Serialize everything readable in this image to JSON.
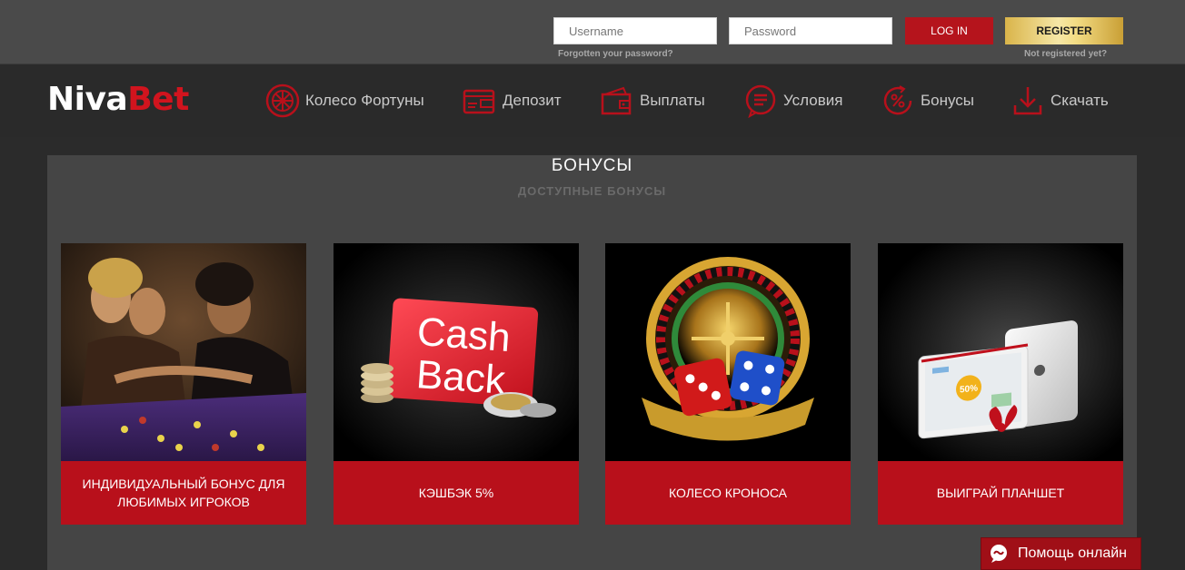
{
  "auth": {
    "username_placeholder": "Username",
    "username_value": "",
    "password_placeholder": "Password",
    "password_value": "",
    "login_label": "LOG IN",
    "register_label": "REGISTER",
    "forgot_label": "Forgotten your password?",
    "not_registered_label": "Not registered yet?"
  },
  "logo": {
    "part1": "Niva",
    "part2": "Bet"
  },
  "nav": {
    "items": [
      {
        "label": "Колесо Фортуны",
        "icon": "wheel-icon"
      },
      {
        "label": "Депозит",
        "icon": "wallet-icon"
      },
      {
        "label": "Выплаты",
        "icon": "purse-icon"
      },
      {
        "label": "Условия",
        "icon": "document-chat-icon"
      },
      {
        "label": "Бонусы",
        "icon": "percent-icon"
      },
      {
        "label": "Скачать",
        "icon": "download-icon"
      }
    ]
  },
  "bonuses": {
    "title": "БОНУСЫ",
    "subtitle": "ДОСТУПНЫЕ БОНУСЫ",
    "cards": [
      {
        "caption": "ИНДИВИДУАЛЬНЫЙ БОНУС ДЛЯ ЛЮБИМЫХ ИГРОКОВ",
        "image": "casino-players-image"
      },
      {
        "caption": "КЭШБЭК 5%",
        "image": "cashback-card-image",
        "image_text_1": "Cash",
        "image_text_2": "Back"
      },
      {
        "caption": "КОЛЕСО КРОНОСА",
        "image": "roulette-dice-image"
      },
      {
        "caption": "ВЫИГРАЙ ПЛАНШЕТ",
        "image": "tablet-gift-image",
        "image_text_1": "50%"
      }
    ]
  },
  "help": {
    "label": "Помощь онлайн",
    "icon": "chat-bubble-icon"
  },
  "colors": {
    "accent": "#b8101b",
    "brand_red": "#d1141e",
    "gold": "#e8cc6a",
    "panel": "#454545"
  }
}
